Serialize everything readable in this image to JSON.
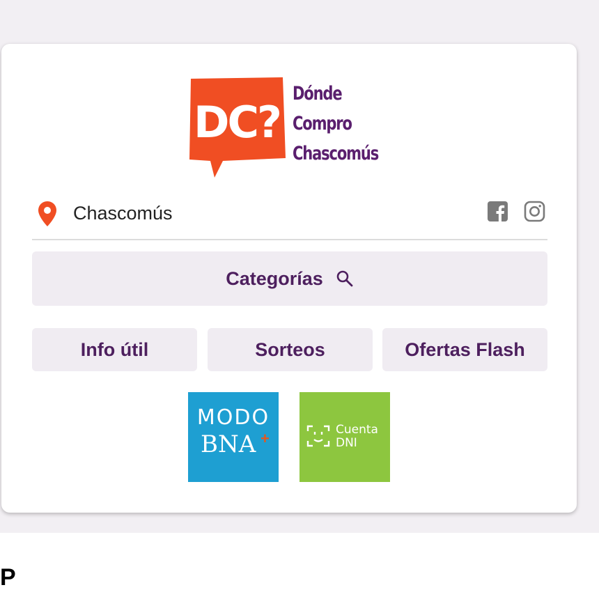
{
  "brand": {
    "logo_mark": "DC?",
    "logo_lines": [
      "Dónde",
      "Compro",
      "Chascomús"
    ],
    "mark_color": "#f04e23",
    "text_color": "#5a1f6e"
  },
  "location": {
    "label": "Chascomús",
    "icon": "map-pin-icon",
    "icon_color": "#f04e23"
  },
  "social": {
    "facebook_icon": "facebook-icon",
    "instagram_icon": "instagram-icon"
  },
  "nav": {
    "categories_label": "Categorías",
    "search_icon": "search-icon",
    "buttons": [
      "Info útil",
      "Sorteos",
      "Ofertas Flash"
    ]
  },
  "payments": {
    "modo": {
      "line1": "MODO",
      "line2": "BNA",
      "plus": "+",
      "color": "#1e9fd2"
    },
    "dni": {
      "line1": "Cuenta",
      "line2": "DNI",
      "color": "#8dc63f"
    }
  },
  "page": {
    "bottom_letter": "P"
  }
}
